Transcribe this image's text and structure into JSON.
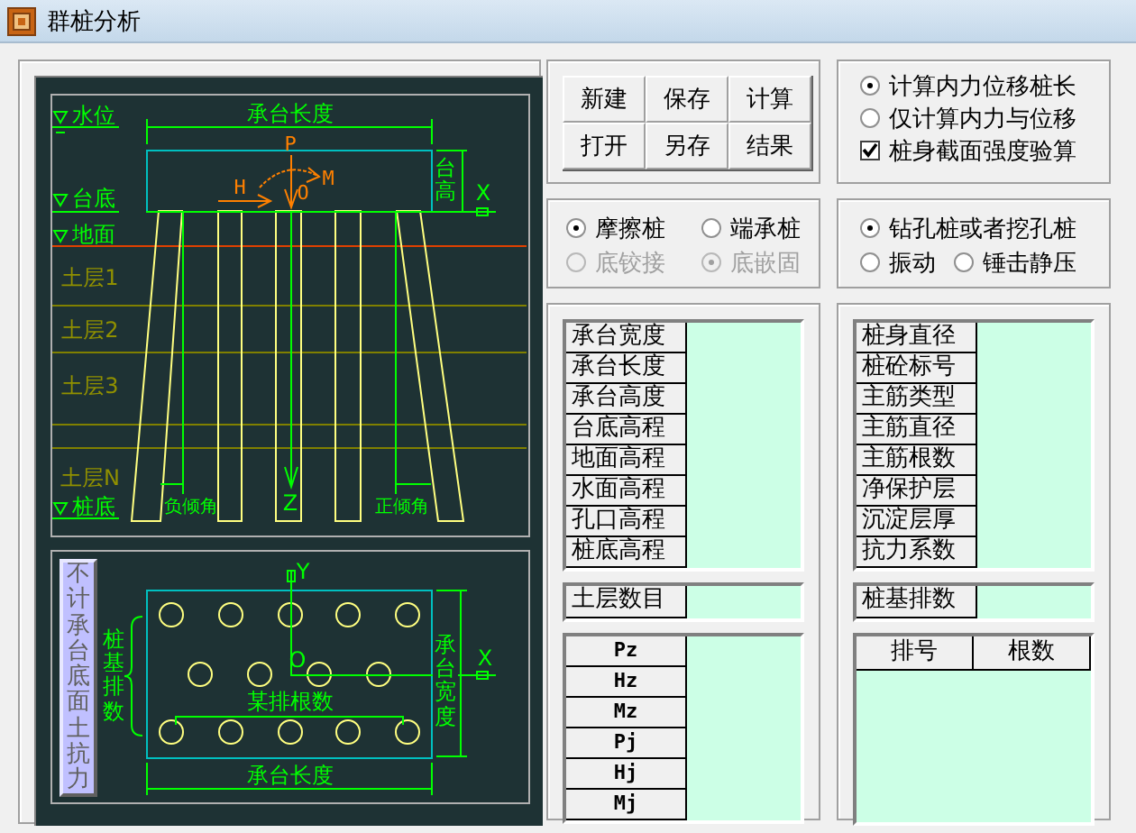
{
  "window": {
    "title": "群桩分析"
  },
  "pile_diagram": {
    "labels": [
      "水位",
      "承台长度",
      "P",
      "M",
      "台底",
      "H",
      "O",
      "台高",
      "X",
      "地面",
      "土层1",
      "土层2",
      "土层3",
      "土层N",
      "桩底",
      "负倾角",
      "Z",
      "正倾角"
    ]
  },
  "plan_diagram": {
    "toggle_button": "不计承台底面土抗力",
    "labels": [
      "Y",
      "承台宽度",
      "桩基排数",
      "O",
      "X",
      "某排根数",
      "承台长度"
    ]
  },
  "file_buttons": [
    "新建",
    "保存",
    "计算",
    "打开",
    "另存",
    "结果"
  ],
  "calc_options": [
    {
      "kind": "radio",
      "label": "计算内力位移桩长",
      "selected": true
    },
    {
      "kind": "radio",
      "label": "仅计算内力与位移",
      "selected": false
    },
    {
      "kind": "checkbox",
      "label": "桩身截面强度验算",
      "checked": true
    }
  ],
  "pile_type": [
    {
      "label": "摩擦桩",
      "selected": true,
      "disabled": false
    },
    {
      "label": "端承桩",
      "selected": false,
      "disabled": false
    },
    {
      "label": "底铰接",
      "selected": false,
      "disabled": true
    },
    {
      "label": "底嵌固",
      "selected": true,
      "disabled": true
    }
  ],
  "construction": [
    {
      "label": "钻孔桩或者挖孔桩",
      "selected": true
    },
    {
      "label": "振动",
      "selected": false
    },
    {
      "label": "锤击静压",
      "selected": false
    }
  ],
  "cap_params": [
    "承台宽度",
    "承台长度",
    "承台高度",
    "台底高程",
    "地面高程",
    "水面高程",
    "孔口高程",
    "桩底高程"
  ],
  "soil_count": {
    "label": "土层数目"
  },
  "loads": [
    "Pz",
    "Hz",
    "Mz",
    "Pj",
    "Hj",
    "Mj"
  ],
  "pile_params": [
    "桩身直径",
    "桩砼标号",
    "主筋类型",
    "主筋直径",
    "主筋根数",
    "净保护层",
    "沉淀层厚",
    "抗力系数"
  ],
  "pile_rows": {
    "label": "桩基排数"
  },
  "row_table": {
    "columns": [
      "排号",
      "根数"
    ]
  }
}
